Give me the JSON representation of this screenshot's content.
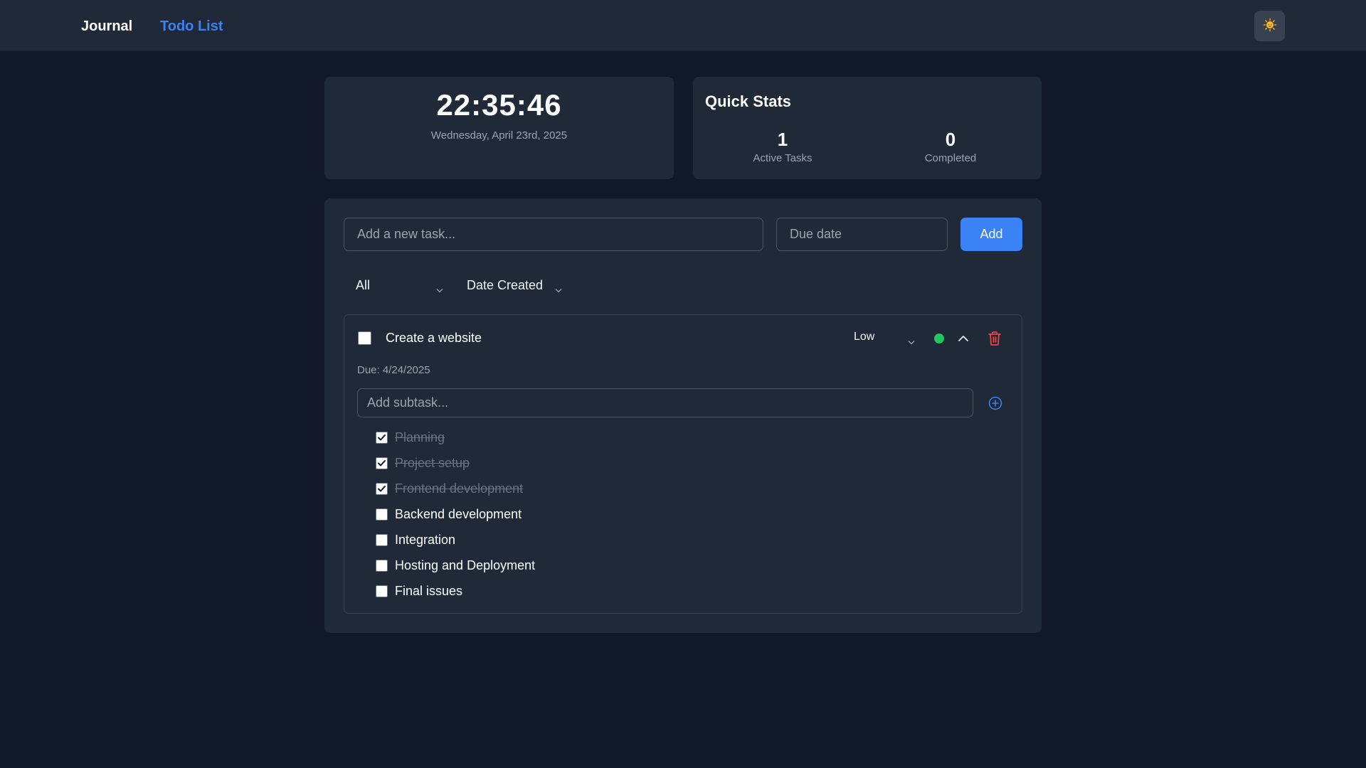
{
  "nav": {
    "journal_label": "Journal",
    "todo_label": "Todo List",
    "active": "Todo List"
  },
  "clock": {
    "time": "22:35:46",
    "date": "Wednesday, April 23rd, 2025"
  },
  "stats": {
    "title": "Quick Stats",
    "active_count": "1",
    "active_label": "Active Tasks",
    "completed_count": "0",
    "completed_label": "Completed"
  },
  "new_task": {
    "placeholder": "Add a new task...",
    "due_placeholder": "Due date",
    "add_label": "Add"
  },
  "filters": {
    "status_value": "All",
    "sort_value": "Date Created"
  },
  "task": {
    "title": "Create a website",
    "checked": false,
    "priority": "Low",
    "status_color": "#22c55e",
    "due": "Due: 4/24/2025",
    "subtask_placeholder": "Add subtask...",
    "subtasks": [
      {
        "label": "Planning",
        "done": true
      },
      {
        "label": "Project setup",
        "done": true
      },
      {
        "label": "Frontend development",
        "done": true
      },
      {
        "label": "Backend development",
        "done": false
      },
      {
        "label": "Integration",
        "done": false
      },
      {
        "label": "Hosting and Deployment",
        "done": false
      },
      {
        "label": "Final issues",
        "done": false
      }
    ]
  },
  "colors": {
    "background": "#111827",
    "card": "#1f2937",
    "accent": "#3b82f6",
    "delete": "#ef4444"
  },
  "icons": {
    "theme": "sun-icon",
    "collapse": "chevron-up-icon",
    "delete": "trash-icon",
    "add_subtask": "plus-circle-icon"
  }
}
